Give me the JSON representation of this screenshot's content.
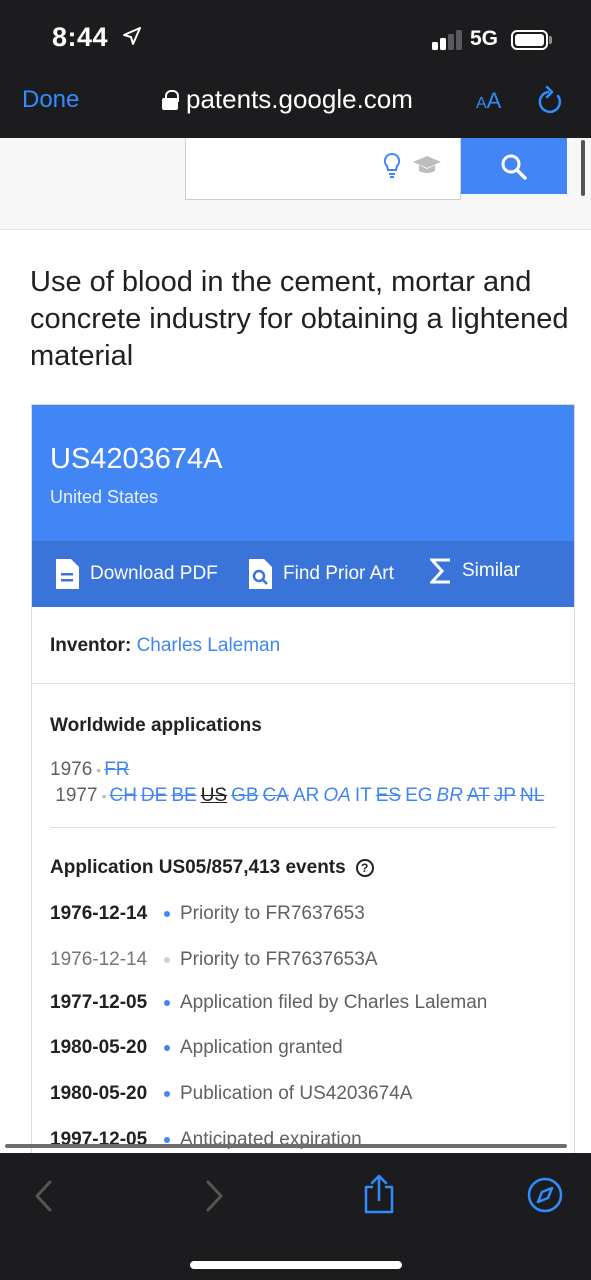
{
  "status_bar": {
    "time": "8:44",
    "network": "5G"
  },
  "browser": {
    "done_label": "Done",
    "url": "patents.google.com",
    "text_size_label_small": "A",
    "text_size_label_large": "A"
  },
  "patent": {
    "title": "Use of blood in the cement, mortar and concrete industry for obtaining a lightened material",
    "number": "US4203674A",
    "country": "United States",
    "actions": {
      "download": "Download PDF",
      "prior_art": "Find Prior Art",
      "similar": "Similar"
    },
    "inventor_label": "Inventor:",
    "inventor_name": "Charles Laleman",
    "worldwide_title": "Worldwide applications",
    "worldwide": {
      "year1": "1976",
      "year1_codes": [
        "FR"
      ],
      "year2": "1977",
      "year2_codes": [
        "CH",
        "DE",
        "BE",
        "US",
        "GB",
        "CA",
        "AR",
        "OA",
        "IT",
        "ES",
        "EG",
        "BR",
        "AT",
        "JP",
        "NL"
      ]
    },
    "events_title": "Application US05/857,413 events",
    "events": [
      {
        "date": "1976-12-14",
        "text": "Priority to FR7637653"
      },
      {
        "date": "1976-12-14",
        "text": "Priority to FR7637653A"
      },
      {
        "date": "1977-12-05",
        "text": "Application filed by Charles Laleman"
      },
      {
        "date": "1980-05-20",
        "text": "Application granted"
      },
      {
        "date": "1980-05-20",
        "text": "Publication of US4203674A"
      },
      {
        "date": "1997-12-05",
        "text": "Anticipated expiration"
      }
    ]
  },
  "colors": {
    "brand_blue": "#4285f4",
    "action_bar": "#3a74d9",
    "ios_blue": "#2f8dff"
  }
}
